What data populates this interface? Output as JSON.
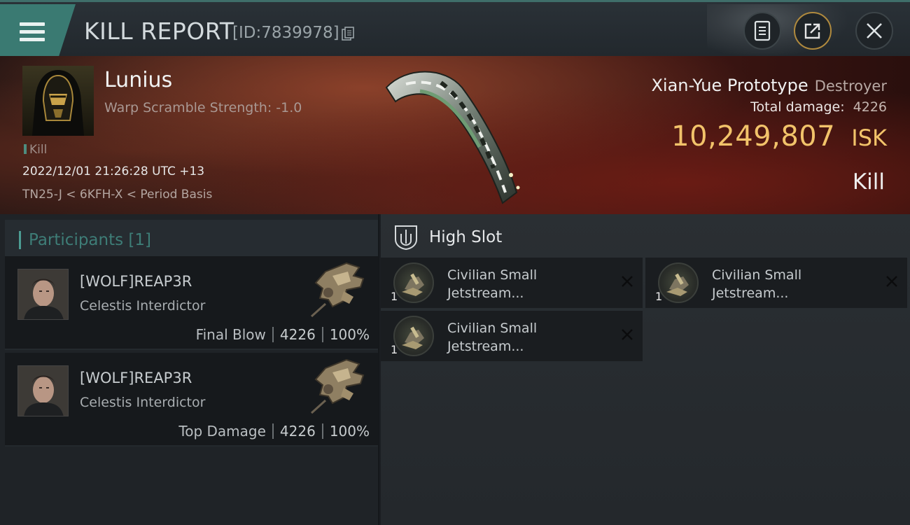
{
  "header": {
    "title": "KILL REPORT",
    "report_id": "[ID:7839978]",
    "icons": [
      "menu-icon",
      "copy-icon",
      "document-icon",
      "export-icon",
      "close-icon"
    ]
  },
  "victim": {
    "name": "Lunius",
    "warp_scramble": "Warp Scramble Strength: -1.0",
    "tag": "Kill",
    "datetime": "2022/12/01 21:26:28 UTC +13",
    "location": "TN25-J < 6KFH-X < Period Basis",
    "ship_name": "Xian-Yue Prototype",
    "ship_class": "Destroyer",
    "total_damage_label": "Total damage:",
    "total_damage": "4226",
    "isk_value": "10,249,807",
    "isk_unit": "ISK",
    "result": "Kill"
  },
  "participants": {
    "title": "Participants [1]",
    "rows": [
      {
        "name": "[WOLF]REAP3R",
        "ship": "Celestis Interdictor",
        "label": "Final Blow",
        "damage": "4226",
        "percent": "100%"
      },
      {
        "name": "[WOLF]REAP3R",
        "ship": "Celestis Interdictor",
        "label": "Top Damage",
        "damage": "4226",
        "percent": "100%"
      }
    ]
  },
  "slots": {
    "title": "High Slot",
    "modules": [
      {
        "name_line1": "Civilian Small",
        "name_line2": "Jetstream...",
        "qty": "1"
      },
      {
        "name_line1": "Civilian Small",
        "name_line2": "Jetstream...",
        "qty": "1"
      },
      {
        "name_line1": "Civilian Small",
        "name_line2": "Jetstream...",
        "qty": "1"
      }
    ]
  },
  "colors": {
    "accent_teal": "#3a7a72",
    "isk_gold": "#f2c36a",
    "participants_title": "#3e7d77"
  }
}
